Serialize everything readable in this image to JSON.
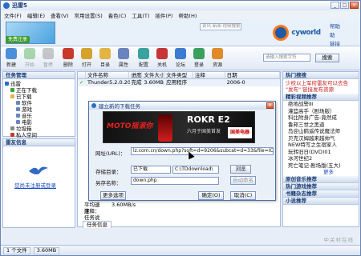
{
  "window": {
    "title": "迅雷5"
  },
  "menu": [
    "文件(F)",
    "编辑(E)",
    "查看(V)",
    "常用设置(S)",
    "着色(C)",
    "工具(T)",
    "插件(P)",
    "帮助(H)"
  ],
  "banner": {
    "register_label": "免费注册",
    "search_placeholder": "资讯·新闻·视频搜索",
    "logo_text": "cyworld",
    "side_links": [
      "帮助",
      "助",
      "链接"
    ]
  },
  "toolbar": {
    "buttons": [
      {
        "label": "新建",
        "icon": "new-icon",
        "enabled": true,
        "color": "#4a8fd9"
      },
      {
        "label": "开始",
        "icon": "play-icon",
        "enabled": false,
        "color": "#3aa33a"
      },
      {
        "label": "暂停",
        "icon": "pause-icon",
        "enabled": false,
        "color": "#7c7c7c"
      },
      {
        "label": "删除",
        "icon": "delete-icon",
        "enabled": true,
        "color": "#c83a2a"
      },
      {
        "label": "打开",
        "icon": "open-icon",
        "enabled": true,
        "color": "#d5a22e"
      },
      {
        "label": "目录",
        "icon": "folder-icon",
        "enabled": true,
        "color": "#e1b443"
      },
      {
        "label": "属性",
        "icon": "properties-icon",
        "enabled": true,
        "color": "#6a84c0"
      },
      {
        "label": "配置",
        "icon": "config-icon",
        "enabled": true,
        "color": "#3aa3a0"
      },
      {
        "label": "关机",
        "icon": "shutdown-icon",
        "enabled": true,
        "color": "#c73636"
      },
      {
        "label": "论坛",
        "icon": "forum-icon",
        "enabled": true,
        "color": "#3c7bd1"
      },
      {
        "label": "登录",
        "icon": "login-icon",
        "enabled": true,
        "color": "#3c9f5e"
      },
      {
        "label": "资源",
        "icon": "resource-icon",
        "enabled": true,
        "color": "#e08a2a"
      }
    ],
    "search_placeholder": "请输入搜索字符",
    "search_button": "搜索"
  },
  "task_panel": {
    "title": "任务管理",
    "tree": [
      {
        "label": "迅雷",
        "color": "#2f6bc4",
        "indent": 0
      },
      {
        "label": "正在下载",
        "color": "#3aa33a",
        "indent": 1
      },
      {
        "label": "已下载",
        "color": "#e1b443",
        "indent": 1
      },
      {
        "label": "软件",
        "color": "#6a84c0",
        "indent": 2
      },
      {
        "label": "游戏",
        "color": "#6a84c0",
        "indent": 2
      },
      {
        "label": "音乐",
        "color": "#6a84c0",
        "indent": 2
      },
      {
        "label": "电影",
        "color": "#6a84c0",
        "indent": 2
      },
      {
        "label": "垃圾箱",
        "color": "#888888",
        "indent": 1
      },
      {
        "label": "私人空间",
        "color": "#c83a2a",
        "indent": 1
      }
    ]
  },
  "info_panel": {
    "title": "雷友信息",
    "login_link": "您尚未注册或登录"
  },
  "task_table": {
    "headers": [
      "",
      "文件名称",
      "进度",
      "文件大小",
      "文件类型",
      "注释",
      "日期"
    ],
    "rows": [
      {
        "status": "✓",
        "name": "Thunder5.2.0.20",
        "progress": "完成",
        "size": "3.60MB",
        "type": "应用程序",
        "note": "",
        "date": "2006-0"
      }
    ],
    "detail": [
      {
        "k": "平均速度：",
        "v": "3.60MB/s"
      },
      {
        "k": "注释：",
        "v": ""
      },
      {
        "k": "任务说明：",
        "v": ""
      }
    ],
    "detail_tab": "任务信息"
  },
  "right_panel": {
    "sec1_title": "热门搜搜",
    "sec1_text": "少校以上军衔雷友可以去告 \"发布\" 链接发布资源",
    "sec2_title": "精彩视频推荐",
    "links": [
      "绝地战警ⅡⅠ",
      "灌篮高手（剧场版）",
      "科比附身广告-竟然成",
      "鲁邦三世之黑道",
      "岛迎山鹤遥传说魔法师",
      "贝克汉姆越来越帅气",
      "NEW特写之生宿家人",
      "玩转旧日(DVD)01",
      "冰河世纪2",
      "死亡笔记·剧场版(五大)"
    ],
    "more": "更多",
    "sec3_title": "原创音乐推荐",
    "sec4_title": "热门游戏推荐",
    "sec5_title": "书籍杂志推荐",
    "sec6_title": "小说推荐"
  },
  "dialog": {
    "title": "建立新的下载任务",
    "ad": {
      "moto": "MOTO摇滚你",
      "rokr": "ROKR E2",
      "sub": "六月于国美首发",
      "gome": "国美电器"
    },
    "url_label": "网址(URL)：",
    "url_value": "lz.com.cn/down.php?soft=d=9206&subcat=d=33&file=IC",
    "category_label": "存储目录：",
    "category_value": "已下载",
    "path_value": "C:\\TDdownload\\",
    "browse_button": "浏览",
    "rename_label": "另存名称：",
    "rename_value": "down.php",
    "auto_rename_button": "自动命名",
    "more_button": "更多选项",
    "ok_button": "确定(O)",
    "cancel_button": "取消(C)"
  },
  "status": {
    "count": "1 个文件",
    "size": "3.60MB"
  },
  "watermark": "中关村在线"
}
